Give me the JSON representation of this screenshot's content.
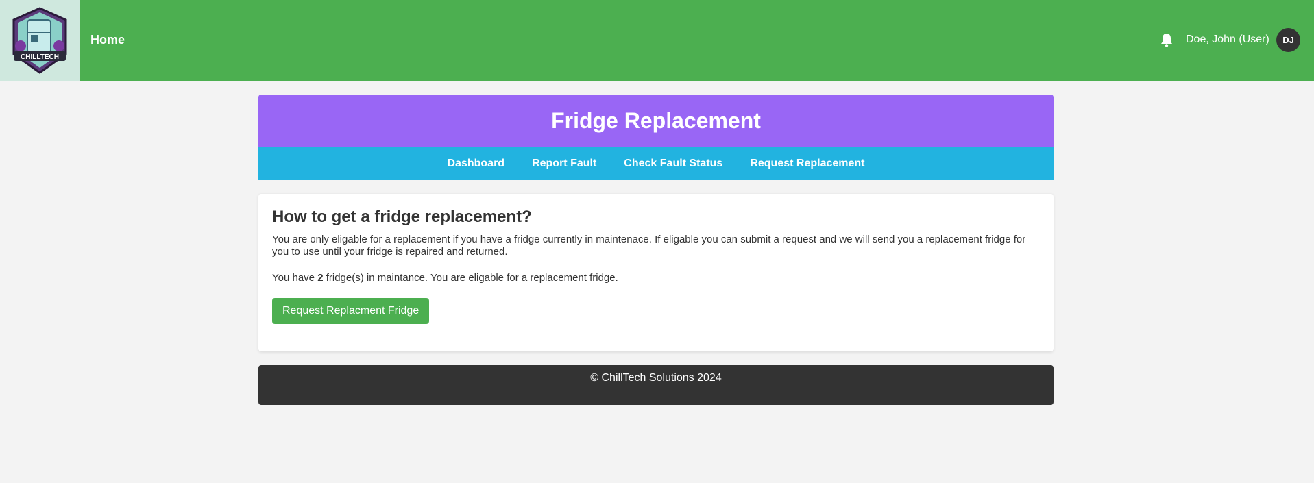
{
  "header": {
    "logo_text": "CHILLTECH",
    "home_label": "Home",
    "user_name": "Doe, John (User)",
    "avatar_initials": "DJ",
    "icons": [
      "bell-icon"
    ]
  },
  "banner": {
    "title": "Fridge Replacement"
  },
  "nav": {
    "items": [
      {
        "label": "Dashboard"
      },
      {
        "label": "Report Fault"
      },
      {
        "label": "Check Fault Status"
      },
      {
        "label": "Request Replacement"
      }
    ]
  },
  "content": {
    "heading": "How to get a fridge replacement?",
    "description": "You are only eligable for a replacement if you have a fridge currently in maintenace. If eligable you can submit a request and we will send you a replacement fridge for you to use until your fridge is repaired and returned.",
    "status_prefix": "You have ",
    "fridge_count": "2",
    "status_suffix": " fridge(s) in maintance. You are eligable for a replacement fridge.",
    "button_label": "Request Replacment Fridge"
  },
  "footer": {
    "text": "© ChillTech Solutions 2024"
  },
  "colors": {
    "header_green": "#4caf50",
    "banner_purple": "#9966f5",
    "nav_blue": "#22b3e0",
    "footer_dark": "#333333"
  }
}
